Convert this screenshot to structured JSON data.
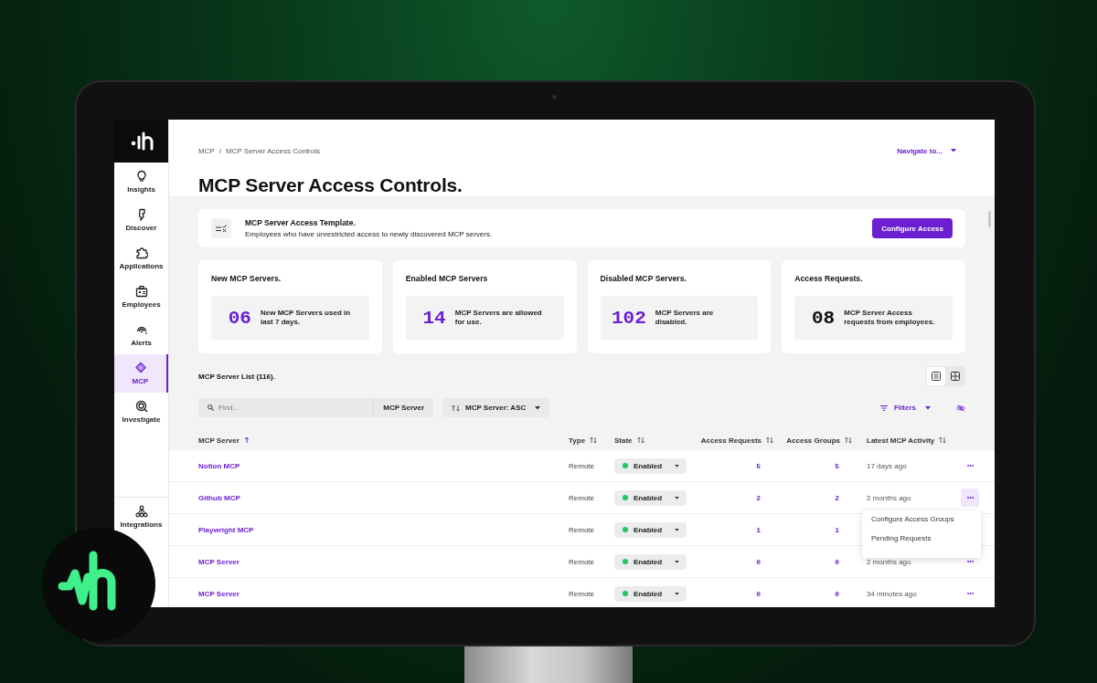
{
  "sidebar": {
    "items": [
      {
        "label": "Insights",
        "selected": false
      },
      {
        "label": "Discover",
        "selected": false
      },
      {
        "label": "Applications",
        "selected": false
      },
      {
        "label": "Employees",
        "selected": false
      },
      {
        "label": "Alerts",
        "selected": false
      },
      {
        "label": "MCP",
        "selected": true
      },
      {
        "label": "Investigate",
        "selected": false
      }
    ],
    "bottom_items": [
      {
        "label": "Integrations",
        "selected": false
      }
    ]
  },
  "breadcrumb": [
    "MCP",
    "/",
    "MCP Server Access Controls"
  ],
  "navigate": "Navigate to...",
  "title": "MCP Server Access Controls.",
  "template": {
    "title": "MCP Server Access Template.",
    "description": "Employees who have unrestricted access to newly discovered MCP servers.",
    "button": "Configure Access"
  },
  "stats": [
    {
      "title": "New MCP Servers.",
      "value": "06",
      "description": "New MCP Servers used in last 7 days.",
      "color": "#6b1fd1"
    },
    {
      "title": "Enabled MCP Servers",
      "value": "14",
      "description": "MCP Servers are allowed for use.",
      "color": "#6b1fd1"
    },
    {
      "title": "Disabled MCP Servers.",
      "value": "102",
      "description": "MCP Servers are disabled.",
      "color": "#6b1fd1"
    },
    {
      "title": "Access Requests.",
      "value": "08",
      "description": "MCP Server Access requests from employees.",
      "color": "#111111"
    }
  ],
  "list_title": "MCP Server List (116).",
  "view_toggle": [
    {
      "kind": "list",
      "selected": true
    },
    {
      "kind": "grid",
      "selected": false
    }
  ],
  "search": {
    "placeholder": "Find...",
    "scope": "MCP Server"
  },
  "sort": "MCP Server: ASC",
  "filters": "Filters",
  "table": {
    "columns": [
      {
        "label": "MCP Server",
        "sorted": true
      },
      {
        "label": "Type",
        "sorted": false
      },
      {
        "label": "State",
        "sorted": false
      },
      {
        "label": "Access Requests",
        "sorted": false
      },
      {
        "label": "Access Groups",
        "sorted": false
      },
      {
        "label": "Latest MCP Activity",
        "sorted": false
      }
    ],
    "rows": [
      {
        "name": "Notion MCP",
        "type": "Remote",
        "state": "Enabled",
        "access_requests": "5",
        "access_groups": "5",
        "latest_activity": "17 days ago",
        "menu_open": false
      },
      {
        "name": "Github MCP",
        "type": "Remote",
        "state": "Enabled",
        "access_requests": "2",
        "access_groups": "2",
        "latest_activity": "2 months ago",
        "menu_open": true
      },
      {
        "name": "Playwright MCP",
        "type": "Remote",
        "state": "Enabled",
        "access_requests": "1",
        "access_groups": "1"
      },
      {
        "name": "MCP Server",
        "type": "Remote",
        "state": "Enabled",
        "access_requests": "0",
        "access_groups": "0",
        "latest_activity": "2 months ago",
        "menu_open": false
      },
      {
        "name": "MCP Server",
        "type": "Remote",
        "state": "Enabled",
        "access_requests": "0",
        "access_groups": "0",
        "latest_activity": "34 minutes ago",
        "menu_open": false
      }
    ]
  },
  "row_menu": {
    "items": [
      "Configure Access Groups",
      "Pending Requests"
    ]
  }
}
